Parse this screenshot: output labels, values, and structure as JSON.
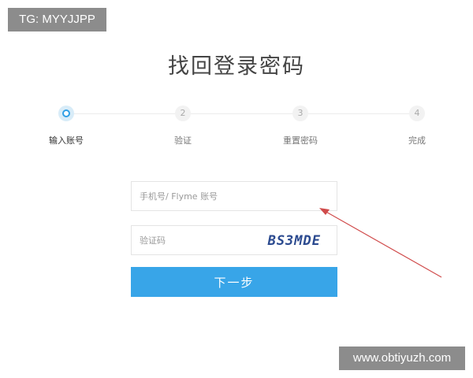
{
  "watermarks": {
    "top_left": "TG: MYYJJPP",
    "bottom_right": "www.obtiyuzh.com"
  },
  "page": {
    "title": "找回登录密码"
  },
  "steps": [
    {
      "number": "",
      "label": "输入账号",
      "active": true
    },
    {
      "number": "2",
      "label": "验证",
      "active": false
    },
    {
      "number": "3",
      "label": "重置密码",
      "active": false
    },
    {
      "number": "4",
      "label": "完成",
      "active": false
    }
  ],
  "form": {
    "account": {
      "placeholder": "手机号/ Flyme 账号",
      "value": ""
    },
    "captcha": {
      "placeholder": "验证码",
      "value": "",
      "image_text": "BS3MDE"
    },
    "next_button": "下一步"
  },
  "colors": {
    "accent": "#38a5e8",
    "annotation_arrow": "#d04b4b",
    "watermark_bg": "#8c8c8c"
  }
}
